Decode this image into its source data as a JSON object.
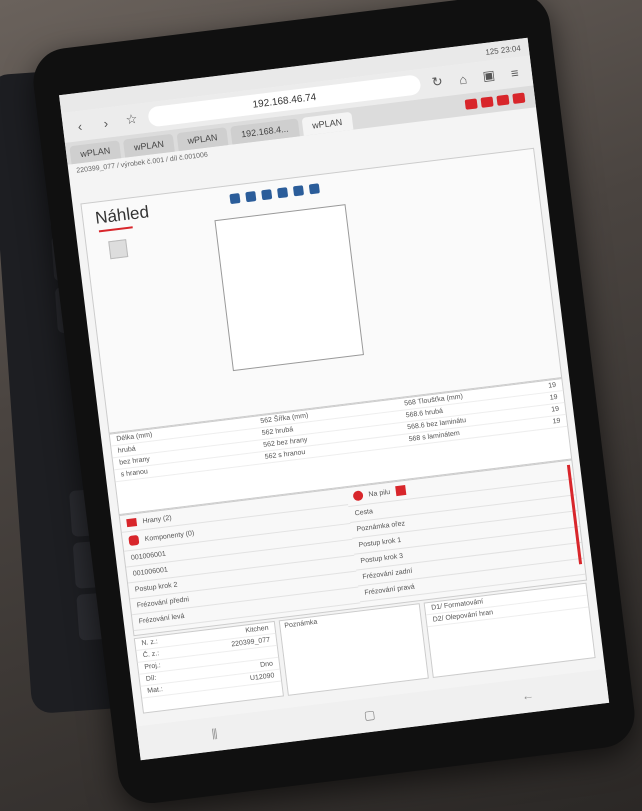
{
  "status": {
    "left": "",
    "right": "125 23:04"
  },
  "browser": {
    "url": "192.168.46.74"
  },
  "tabs": [
    "wPLAN",
    "wPLAN",
    "wPLAN",
    "192.168.4...",
    "wPLAN"
  ],
  "breadcrumb": "220399_077 / výrobek č.001 / díl č.001006",
  "panel": {
    "title": "Náhled"
  },
  "dims": {
    "rows": [
      [
        "Délka (mm)",
        "562 Šířka (mm)",
        "568 Tloušťka (mm)",
        "19"
      ],
      [
        "hrubá",
        "562 hrubá",
        "568.6 hrubá",
        "19"
      ],
      [
        "bez hrany",
        "562 bez hrany",
        "568.6 bez laminátu",
        "19"
      ],
      [
        "s hranou",
        "562 s hranou",
        "568 s laminátem",
        "19"
      ]
    ]
  },
  "features": {
    "left": [
      "Hrany (2)",
      "Komponenty (0)",
      "001006001",
      "001006001",
      "Postup krok 2",
      "Frézování předni",
      "Frézování levá"
    ],
    "right": [
      "Na pilu",
      "Cesta",
      "Poznámka ořez",
      "Postup krok 1",
      "Postup krok 3",
      "Frézování zadní",
      "Frézování pravá"
    ]
  },
  "info": {
    "labels": [
      "N. z.:",
      "Č. z.:",
      "Proj.:",
      "Díl:",
      "Mat.:"
    ],
    "values": [
      "Kitchen",
      "220399_077",
      "",
      "Dno",
      "U12090"
    ],
    "note_label": "Poznámka",
    "ops": [
      "D1/ Formatování",
      "D2/ Olepování hran"
    ]
  },
  "colors": {
    "accent": "#d8262b"
  }
}
